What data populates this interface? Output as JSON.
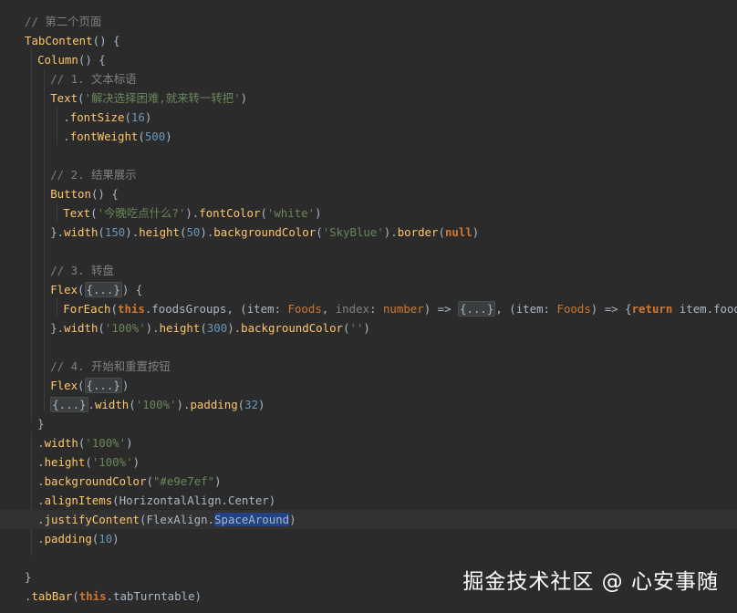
{
  "editor": {
    "lines": [
      {
        "indent": 0,
        "parts": [
          {
            "t": "// 第二个页面",
            "c": "cmt"
          }
        ]
      },
      {
        "indent": 0,
        "parts": [
          {
            "t": "TabContent",
            "c": "fn"
          },
          {
            "t": "() {",
            "c": ""
          }
        ]
      },
      {
        "indent": 1,
        "parts": [
          {
            "t": "Column",
            "c": "fn"
          },
          {
            "t": "() {",
            "c": ""
          }
        ]
      },
      {
        "indent": 2,
        "parts": [
          {
            "t": "// 1. 文本标语",
            "c": "cmt"
          }
        ]
      },
      {
        "indent": 2,
        "parts": [
          {
            "t": "Text",
            "c": "fn"
          },
          {
            "t": "(",
            "c": ""
          },
          {
            "t": "'解决选择困难,就来转一转把'",
            "c": "str"
          },
          {
            "t": ")",
            "c": ""
          }
        ]
      },
      {
        "indent": 3,
        "parts": [
          {
            "t": ".",
            "c": ""
          },
          {
            "t": "fontSize",
            "c": "fn"
          },
          {
            "t": "(",
            "c": ""
          },
          {
            "t": "16",
            "c": "num"
          },
          {
            "t": ")",
            "c": ""
          }
        ]
      },
      {
        "indent": 3,
        "parts": [
          {
            "t": ".",
            "c": ""
          },
          {
            "t": "fontWeight",
            "c": "fn"
          },
          {
            "t": "(",
            "c": ""
          },
          {
            "t": "500",
            "c": "num"
          },
          {
            "t": ")",
            "c": ""
          }
        ]
      },
      {
        "indent": 0,
        "parts": []
      },
      {
        "indent": 2,
        "parts": [
          {
            "t": "// 2. 结果展示",
            "c": "cmt"
          }
        ]
      },
      {
        "indent": 2,
        "parts": [
          {
            "t": "Button",
            "c": "fn"
          },
          {
            "t": "() {",
            "c": ""
          }
        ]
      },
      {
        "indent": 3,
        "parts": [
          {
            "t": "Text",
            "c": "fn"
          },
          {
            "t": "(",
            "c": ""
          },
          {
            "t": "'今晚吃点什么?'",
            "c": "str"
          },
          {
            "t": ").",
            "c": ""
          },
          {
            "t": "fontColor",
            "c": "fn"
          },
          {
            "t": "(",
            "c": ""
          },
          {
            "t": "'white'",
            "c": "str"
          },
          {
            "t": ")",
            "c": ""
          }
        ]
      },
      {
        "indent": 2,
        "parts": [
          {
            "t": "}.",
            "c": ""
          },
          {
            "t": "width",
            "c": "fn"
          },
          {
            "t": "(",
            "c": ""
          },
          {
            "t": "150",
            "c": "num"
          },
          {
            "t": ").",
            "c": ""
          },
          {
            "t": "height",
            "c": "fn"
          },
          {
            "t": "(",
            "c": ""
          },
          {
            "t": "50",
            "c": "num"
          },
          {
            "t": ").",
            "c": ""
          },
          {
            "t": "backgroundColor",
            "c": "fn"
          },
          {
            "t": "(",
            "c": ""
          },
          {
            "t": "'SkyBlue'",
            "c": "str"
          },
          {
            "t": ").",
            "c": ""
          },
          {
            "t": "border",
            "c": "fn"
          },
          {
            "t": "(",
            "c": ""
          },
          {
            "t": "null",
            "c": "kw"
          },
          {
            "t": ")",
            "c": ""
          }
        ]
      },
      {
        "indent": 0,
        "parts": []
      },
      {
        "indent": 2,
        "parts": [
          {
            "t": "// 3. 转盘",
            "c": "cmt"
          }
        ]
      },
      {
        "indent": 2,
        "parts": [
          {
            "t": "Flex",
            "c": "fn"
          },
          {
            "t": "(",
            "c": ""
          },
          {
            "t": "{...}",
            "c": "fold"
          },
          {
            "t": ") {",
            "c": ""
          }
        ]
      },
      {
        "indent": 3,
        "parts": [
          {
            "t": "ForEach",
            "c": "fn"
          },
          {
            "t": "(",
            "c": ""
          },
          {
            "t": "this",
            "c": "kw"
          },
          {
            "t": ".foodsGroups, (item: ",
            "c": ""
          },
          {
            "t": "Foods",
            "c": "type"
          },
          {
            "t": ", ",
            "c": ""
          },
          {
            "t": "index",
            "c": "muted"
          },
          {
            "t": ": ",
            "c": ""
          },
          {
            "t": "number",
            "c": "type"
          },
          {
            "t": ") => ",
            "c": ""
          },
          {
            "t": "{...}",
            "c": "fold"
          },
          {
            "t": ", (item: ",
            "c": ""
          },
          {
            "t": "Foods",
            "c": "type"
          },
          {
            "t": ") => {",
            "c": ""
          },
          {
            "t": "return",
            "c": "kw"
          },
          {
            "t": " item.foodName})",
            "c": ""
          }
        ]
      },
      {
        "indent": 2,
        "parts": [
          {
            "t": "}.",
            "c": ""
          },
          {
            "t": "width",
            "c": "fn"
          },
          {
            "t": "(",
            "c": ""
          },
          {
            "t": "'100%'",
            "c": "str"
          },
          {
            "t": ").",
            "c": ""
          },
          {
            "t": "height",
            "c": "fn"
          },
          {
            "t": "(",
            "c": ""
          },
          {
            "t": "300",
            "c": "num"
          },
          {
            "t": ").",
            "c": ""
          },
          {
            "t": "backgroundColor",
            "c": "fn"
          },
          {
            "t": "(",
            "c": ""
          },
          {
            "t": "''",
            "c": "str"
          },
          {
            "t": ")",
            "c": ""
          }
        ]
      },
      {
        "indent": 0,
        "parts": []
      },
      {
        "indent": 2,
        "parts": [
          {
            "t": "// 4. 开始和重置按钮",
            "c": "cmt"
          }
        ]
      },
      {
        "indent": 2,
        "parts": [
          {
            "t": "Flex",
            "c": "fn"
          },
          {
            "t": "(",
            "c": ""
          },
          {
            "t": "{...}",
            "c": "fold"
          },
          {
            "t": ")",
            "c": ""
          }
        ]
      },
      {
        "indent": 2,
        "parts": [
          {
            "t": "{...}",
            "c": "fold"
          },
          {
            "t": ".",
            "c": ""
          },
          {
            "t": "width",
            "c": "fn"
          },
          {
            "t": "(",
            "c": ""
          },
          {
            "t": "'100%'",
            "c": "str"
          },
          {
            "t": ").",
            "c": ""
          },
          {
            "t": "padding",
            "c": "fn"
          },
          {
            "t": "(",
            "c": ""
          },
          {
            "t": "32",
            "c": "num"
          },
          {
            "t": ")",
            "c": ""
          }
        ]
      },
      {
        "indent": 1,
        "parts": [
          {
            "t": "}",
            "c": ""
          }
        ]
      },
      {
        "indent": 1,
        "parts": [
          {
            "t": ".",
            "c": ""
          },
          {
            "t": "width",
            "c": "fn"
          },
          {
            "t": "(",
            "c": ""
          },
          {
            "t": "'100%'",
            "c": "str"
          },
          {
            "t": ")",
            "c": ""
          }
        ]
      },
      {
        "indent": 1,
        "parts": [
          {
            "t": ".",
            "c": ""
          },
          {
            "t": "height",
            "c": "fn"
          },
          {
            "t": "(",
            "c": ""
          },
          {
            "t": "'100%'",
            "c": "str"
          },
          {
            "t": ")",
            "c": ""
          }
        ]
      },
      {
        "indent": 1,
        "parts": [
          {
            "t": ".",
            "c": ""
          },
          {
            "t": "backgroundColor",
            "c": "fn"
          },
          {
            "t": "(",
            "c": ""
          },
          {
            "t": "\"#e9e7ef\"",
            "c": "str"
          },
          {
            "t": ")",
            "c": ""
          }
        ]
      },
      {
        "indent": 1,
        "parts": [
          {
            "t": ".",
            "c": ""
          },
          {
            "t": "alignItems",
            "c": "fn"
          },
          {
            "t": "(HorizontalAlign.Center)",
            "c": ""
          }
        ]
      },
      {
        "indent": 1,
        "current": true,
        "parts": [
          {
            "t": ".",
            "c": ""
          },
          {
            "t": "justifyContent",
            "c": "fn"
          },
          {
            "t": "(FlexAlign.",
            "c": ""
          },
          {
            "t": "SpaceAround",
            "c": "sel"
          },
          {
            "t": ")",
            "c": ""
          }
        ]
      },
      {
        "indent": 1,
        "parts": [
          {
            "t": ".",
            "c": ""
          },
          {
            "t": "padding",
            "c": "fn"
          },
          {
            "t": "(",
            "c": ""
          },
          {
            "t": "10",
            "c": "num"
          },
          {
            "t": ")",
            "c": ""
          }
        ]
      },
      {
        "indent": 0,
        "parts": []
      },
      {
        "indent": 0,
        "parts": [
          {
            "t": "}",
            "c": ""
          }
        ]
      },
      {
        "indent": 0,
        "parts": [
          {
            "t": ".",
            "c": ""
          },
          {
            "t": "tabBar",
            "c": "fn"
          },
          {
            "t": "(",
            "c": ""
          },
          {
            "t": "this",
            "c": "kw"
          },
          {
            "t": ".tabTurntable)",
            "c": ""
          }
        ]
      }
    ]
  },
  "watermark": {
    "text": "掘金技术社区 @ 心安事随"
  },
  "colors": {
    "background": "#2b2b2b",
    "comment": "#808080",
    "string": "#6a8759",
    "number": "#6897bb",
    "keyword": "#cc7832",
    "function": "#ffc66d",
    "selection": "#214283"
  }
}
